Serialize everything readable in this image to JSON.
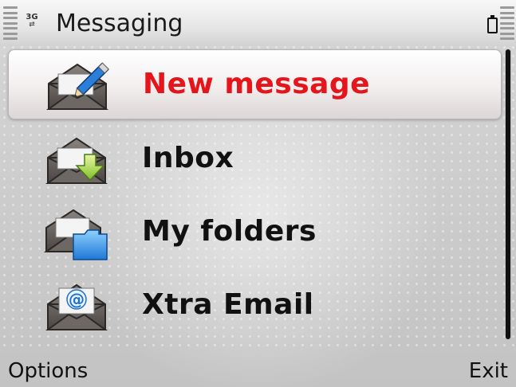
{
  "title_bar": {
    "network_indicator": "3G",
    "title": "Messaging"
  },
  "menu": {
    "items": [
      {
        "label": "New message",
        "icon": "new-message-icon",
        "selected": true
      },
      {
        "label": "Inbox",
        "icon": "inbox-icon",
        "selected": false
      },
      {
        "label": "My folders",
        "icon": "my-folders-icon",
        "selected": false
      },
      {
        "label": "Xtra Email",
        "icon": "email-icon",
        "selected": false
      }
    ]
  },
  "softkeys": {
    "left": "Options",
    "right": "Exit"
  },
  "colors": {
    "selected_text": "#e4151b",
    "text": "#111111"
  }
}
